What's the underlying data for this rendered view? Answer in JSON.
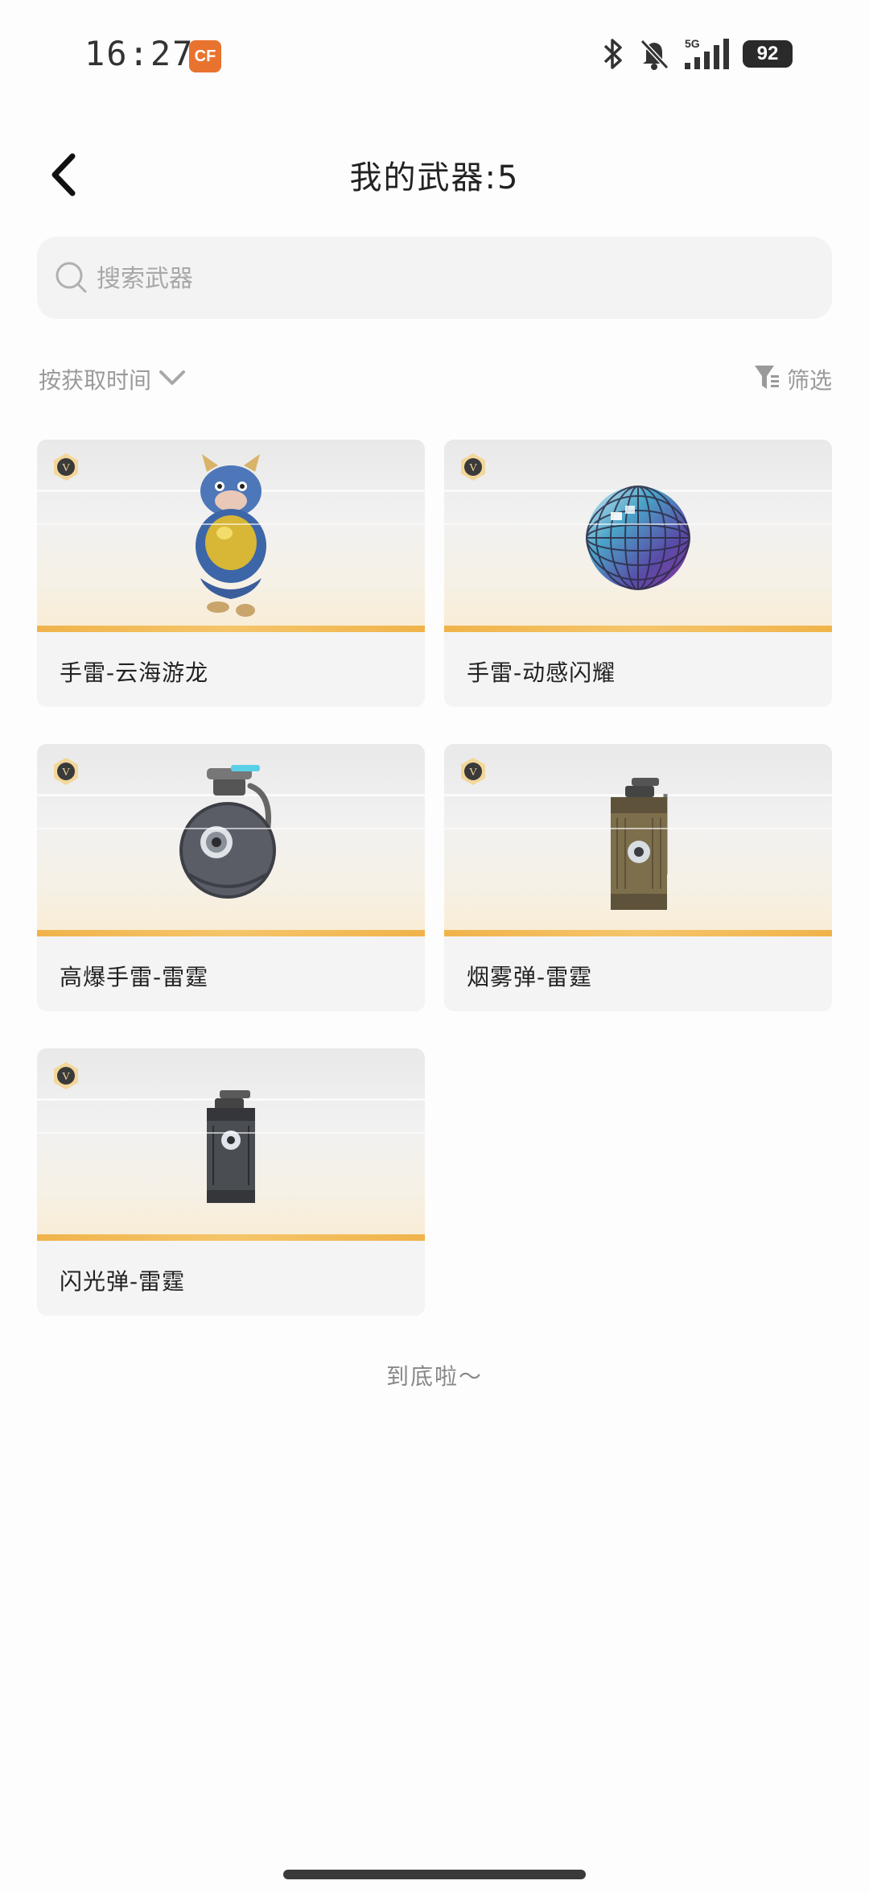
{
  "status_bar": {
    "time": "16:27",
    "app_icon_label": "CF",
    "network": "5G",
    "battery": "92",
    "icons": [
      "bluetooth-icon",
      "mute-bell-icon",
      "signal-icon",
      "battery-icon"
    ]
  },
  "header": {
    "title": "我的武器:5",
    "back_icon": "chevron-left-icon"
  },
  "search": {
    "placeholder": "搜索武器",
    "value": ""
  },
  "sort": {
    "label": "按获取时间",
    "icon": "chevron-down-icon"
  },
  "filter": {
    "label": "筛选",
    "icon": "filter-icon"
  },
  "weapons": [
    {
      "name": "手雷-云海游龙",
      "badge": "V",
      "art": "dragon-doll-grenade"
    },
    {
      "name": "手雷-动感闪耀",
      "badge": "V",
      "art": "disco-ball-grenade"
    },
    {
      "name": "高爆手雷-雷霆",
      "badge": "V",
      "art": "round-frag-grenade"
    },
    {
      "name": "烟雾弹-雷霆",
      "badge": "V",
      "art": "smoke-canister"
    },
    {
      "name": "闪光弹-雷霆",
      "badge": "V",
      "art": "flash-canister"
    }
  ],
  "footer": {
    "end_text": "到底啦～"
  },
  "colors": {
    "accent_bar": "#f0b34a",
    "card_bg": "#f4f4f4",
    "search_bg": "#f3f3f3",
    "muted_text": "#9a9a9a"
  }
}
